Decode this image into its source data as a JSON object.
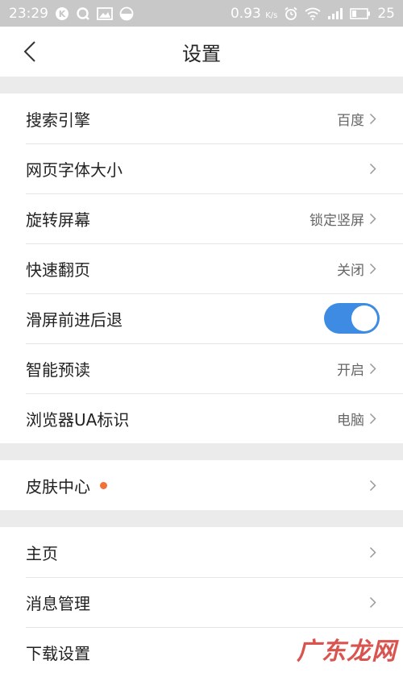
{
  "status_bar": {
    "time": "23:29",
    "data_rate": "0.93",
    "data_unit": "K/s",
    "battery": "25"
  },
  "header": {
    "title": "设置"
  },
  "sections": [
    {
      "rows": [
        {
          "label": "搜索引擎",
          "value": "百度",
          "control": "chevron"
        },
        {
          "label": "网页字体大小",
          "value": "",
          "control": "chevron"
        },
        {
          "label": "旋转屏幕",
          "value": "锁定竖屏",
          "control": "chevron"
        },
        {
          "label": "快速翻页",
          "value": "关闭",
          "control": "chevron"
        },
        {
          "label": "滑屏前进后退",
          "value": "",
          "control": "toggle",
          "toggle_on": true
        },
        {
          "label": "智能预读",
          "value": "开启",
          "control": "chevron"
        },
        {
          "label": "浏览器UA标识",
          "value": "电脑",
          "control": "chevron"
        }
      ]
    },
    {
      "rows": [
        {
          "label": "皮肤中心",
          "value": "",
          "control": "chevron",
          "badge_dot": true
        }
      ]
    },
    {
      "rows": [
        {
          "label": "主页",
          "value": "",
          "control": "chevron"
        },
        {
          "label": "消息管理",
          "value": "",
          "control": "chevron"
        },
        {
          "label": "下载设置",
          "value": "",
          "control": "chevron"
        }
      ]
    }
  ],
  "watermark": "广东龙网",
  "colors": {
    "toggle_on": "#3d8be3",
    "badge_dot": "#f2703a",
    "status_bar_bg": "#c8c8c8"
  }
}
